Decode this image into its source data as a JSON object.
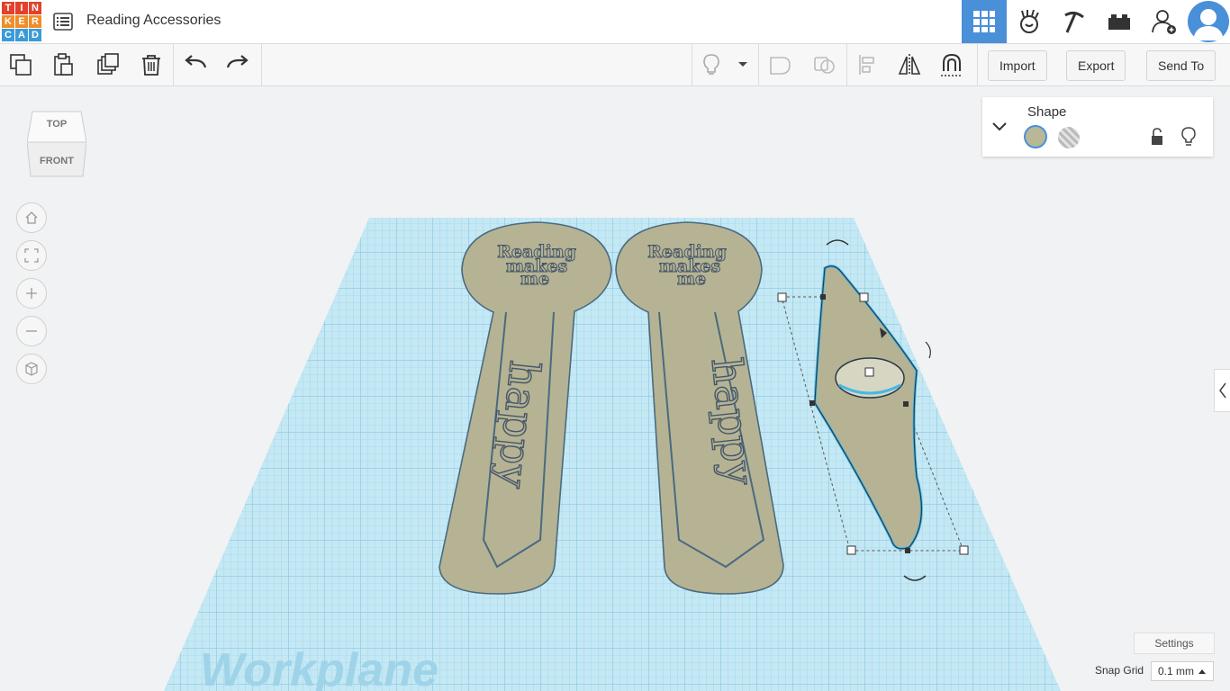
{
  "app": {
    "logo_letters": [
      "T",
      "I",
      "N",
      "K",
      "E",
      "R",
      "C",
      "A",
      "D"
    ],
    "logo_colors": [
      "#e2412c",
      "#e2412c",
      "#e2412c",
      "#ef8d27",
      "#ef8d27",
      "#ef8d27",
      "#3a9bd8",
      "#3a9bd8",
      "#3a9bd8"
    ],
    "title": "Reading Accessories"
  },
  "topbar": {
    "buttons": [
      {
        "name": "3d-design-view-button",
        "icon": "grid-icon",
        "active": true
      },
      {
        "name": "blocks-view-button",
        "icon": "codeblocks-icon"
      },
      {
        "name": "bricks-view-button",
        "icon": "pickaxe-icon"
      },
      {
        "name": "lego-view-button",
        "icon": "brick-icon"
      },
      {
        "name": "invite-user-button",
        "icon": "add-user-icon"
      }
    ]
  },
  "toolbar": {
    "import_label": "Import",
    "export_label": "Export",
    "send_to_label": "Send To"
  },
  "viewcube": {
    "top": "TOP",
    "front": "FRONT"
  },
  "workplane_label": "Workplane",
  "bookmarks": [
    {
      "line1": "Reading",
      "line2": "makes",
      "line3": "me",
      "vertical": "happy"
    },
    {
      "line1": "Reading",
      "line2": "makes",
      "line3": "me",
      "vertical": "happy"
    }
  ],
  "inspector": {
    "title": "Shape",
    "solid_color": "#b8b896"
  },
  "settings_label": "Settings",
  "snap": {
    "label": "Snap Grid",
    "value": "0.1 mm"
  },
  "colors": {
    "accent": "#4a90d9",
    "grid": "#9dd6ee",
    "shape": "#b5b393"
  }
}
